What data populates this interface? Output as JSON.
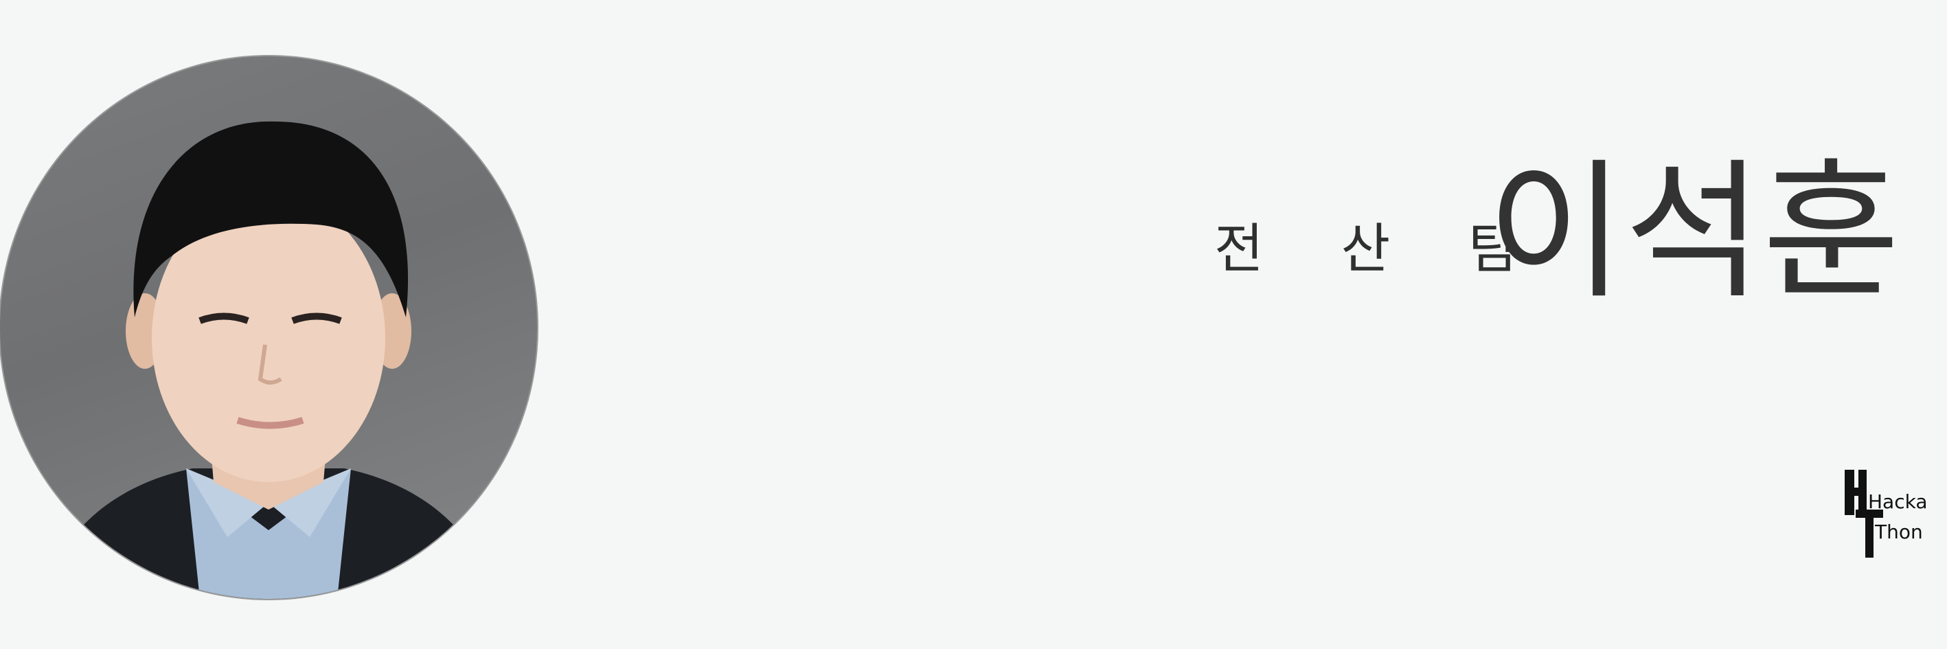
{
  "profile": {
    "team": "전 산 팀",
    "name": "이석훈"
  },
  "logo": {
    "line1": "Hacka",
    "line2": "Thon"
  },
  "colors": {
    "background": "#f5f6f6",
    "text": "#333333"
  }
}
